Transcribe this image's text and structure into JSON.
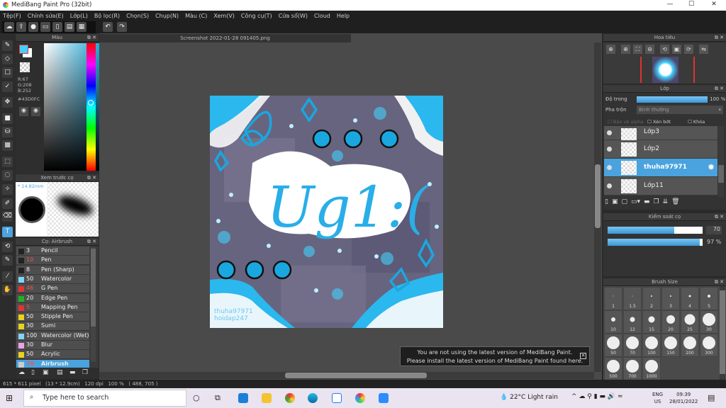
{
  "window": {
    "title": "MediBang Paint Pro (32bit)",
    "controls": [
      "—",
      "☐",
      "✕"
    ]
  },
  "menu": [
    "Tệp(F)",
    "Chỉnh sửa(E)",
    "Lớp(L)",
    "Bộ lọc(R)",
    "Chọn(S)",
    "Chụp(N)",
    "Màu (C)",
    "Xem(V)",
    "Công cụ(T)",
    "Cửa sổ(W)",
    "Cloud",
    "Help"
  ],
  "toolbar": {
    "icons": [
      "cloud-icon",
      "share-icon",
      "comment-icon",
      "caption-icon",
      "page-icon",
      "panel-icon",
      "edit-panel-icon"
    ],
    "undo": "↶",
    "redo": "↷"
  },
  "color_panel": {
    "title": "Màu",
    "r": "R:67",
    "g": "G:208",
    "b": "B:252",
    "hex": "#43D0FC",
    "fg": "#43D0FC"
  },
  "brush_preview": {
    "title": "Xem trước cọ",
    "size": "* 14.82mm"
  },
  "brush_panel": {
    "title": "Cọ: Airbrush",
    "items": [
      {
        "size": "3",
        "name": "Pencil",
        "color": "#222222",
        "red": false
      },
      {
        "size": "10",
        "name": "Pen",
        "color": "#222222",
        "red": true
      },
      {
        "size": "8",
        "name": "Pen (Sharp)",
        "color": "#222222",
        "red": false
      },
      {
        "size": "50",
        "name": "Watercolor",
        "color": "#7fd7f5",
        "red": false
      },
      {
        "size": "46",
        "name": "G Pen",
        "color": "#e33333",
        "red": true
      },
      {
        "size": "20",
        "name": "Edge Pen",
        "color": "#22b022",
        "red": false
      },
      {
        "size": "5",
        "name": "Mapping Pen",
        "color": "#e33333",
        "red": true
      },
      {
        "size": "50",
        "name": "Stipple Pen",
        "color": "#e8d21a",
        "red": false
      },
      {
        "size": "30",
        "name": "Sumi",
        "color": "#e8d21a",
        "red": false
      },
      {
        "size": "100",
        "name": "Watercolor (Wet)",
        "color": "#7fd7f5",
        "red": false
      },
      {
        "size": "30",
        "name": "Blur",
        "color": "#f0a0e8",
        "red": false
      },
      {
        "size": "50",
        "name": "Acrylic",
        "color": "#e8d21a",
        "red": false
      },
      {
        "size": "70",
        "name": "Airbrush",
        "color": "#cccccc",
        "red": true,
        "selected": true
      }
    ]
  },
  "document": {
    "tab": "Screenshot 2022-01-28 091405.png",
    "watermark1": "thuha97971",
    "watermark2": "hoidap247"
  },
  "notice": {
    "line1": "You are not using the latest version of MediBang Paint.",
    "line2": "Please install the latest version of MediBang Paint found here."
  },
  "navigator": {
    "title": "Hoa tiêu"
  },
  "layers": {
    "title": "Lớp",
    "opacity_label": "Độ trong",
    "opacity": "100 %",
    "opacity_value": 100,
    "blend_label": "Pha trộn",
    "blend": "Bình thường",
    "protect_alpha": "Bảo vệ alpha",
    "clipping": "Xén bớt",
    "lock": "Khóa",
    "items": [
      {
        "name": "Lớp3",
        "selected": false
      },
      {
        "name": "Lớp2",
        "selected": false
      },
      {
        "name": "thuha97971",
        "selected": true
      },
      {
        "name": "Lớp11",
        "selected": false
      }
    ]
  },
  "brush_control": {
    "title": "Kiểm soát cọ",
    "size": "70",
    "size_fraction": 0.7,
    "opacity": "97 %",
    "opacity_fraction": 0.97
  },
  "brush_size": {
    "title": "Brush Size",
    "sizes": [
      "1",
      "1.5",
      "2",
      "3",
      "4",
      "5",
      "10",
      "12",
      "15",
      "20",
      "25",
      "30",
      "50",
      "70",
      "100",
      "150",
      "200",
      "300",
      "500",
      "700",
      "1000"
    ]
  },
  "status": "615 * 611 pixel   (13 * 12.9cm)   120 dpi   100 %   ( 488, 705 )",
  "taskbar": {
    "search": "Type here to search",
    "weather": "22°C  Light rain",
    "lang1": "ENG",
    "lang2": "US",
    "time": "09:39",
    "date": "28/01/2022"
  }
}
